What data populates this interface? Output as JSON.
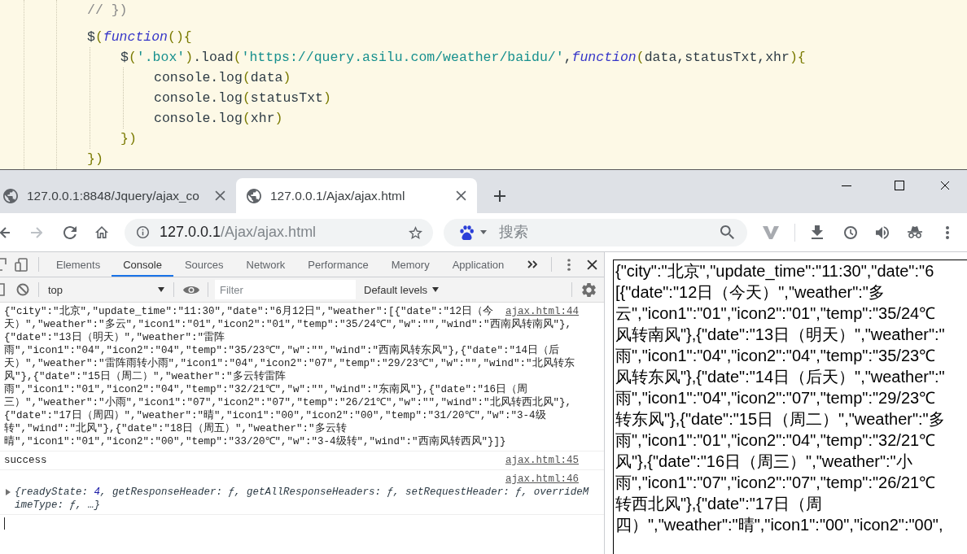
{
  "editor": {
    "lines": [
      {
        "kind": "code",
        "tokens": [
          {
            "kind": "comment",
            "text": "// })"
          }
        ]
      },
      {
        "kind": "blank"
      },
      {
        "kind": "code",
        "tokens": [
          {
            "kind": "plain",
            "text": "$"
          },
          {
            "kind": "punct",
            "text": "("
          },
          {
            "kind": "keyword",
            "text": "function"
          },
          {
            "kind": "punct",
            "text": "(){"
          }
        ],
        "children": [
          {
            "kind": "code",
            "tokens": [
              {
                "kind": "plain",
                "text": "$"
              },
              {
                "kind": "punct",
                "text": "("
              },
              {
                "kind": "string",
                "text": "'.box'"
              },
              {
                "kind": "punct",
                "text": ")"
              },
              {
                "kind": "plain",
                "text": ".load"
              },
              {
                "kind": "punct",
                "text": "("
              },
              {
                "kind": "string",
                "text": "'https://query.asilu.com/weather/baidu/'"
              },
              {
                "kind": "plain",
                "text": ","
              },
              {
                "kind": "keyword",
                "text": "function"
              },
              {
                "kind": "punct",
                "text": "("
              },
              {
                "kind": "plain",
                "text": "data,statusTxt,xhr"
              },
              {
                "kind": "punct",
                "text": "){"
              }
            ],
            "children": [
              {
                "kind": "code",
                "tokens": [
                  {
                    "kind": "plain",
                    "text": "console.log"
                  },
                  {
                    "kind": "punct",
                    "text": "("
                  },
                  {
                    "kind": "plain",
                    "text": "data"
                  },
                  {
                    "kind": "punct",
                    "text": ")"
                  }
                ]
              },
              {
                "kind": "code",
                "tokens": [
                  {
                    "kind": "plain",
                    "text": "console.log"
                  },
                  {
                    "kind": "punct",
                    "text": "("
                  },
                  {
                    "kind": "plain",
                    "text": "statusTxt"
                  },
                  {
                    "kind": "punct",
                    "text": ")"
                  }
                ]
              },
              {
                "kind": "code",
                "tokens": [
                  {
                    "kind": "plain",
                    "text": "console.log"
                  },
                  {
                    "kind": "punct",
                    "text": "("
                  },
                  {
                    "kind": "plain",
                    "text": "xhr"
                  },
                  {
                    "kind": "punct",
                    "text": ")"
                  }
                ]
              }
            ]
          },
          {
            "kind": "code",
            "tokens": [
              {
                "kind": "punct",
                "text": "})"
              }
            ]
          }
        ]
      },
      {
        "kind": "code",
        "tokens": [
          {
            "kind": "punct",
            "text": "})"
          }
        ]
      }
    ]
  },
  "browser": {
    "tabs": [
      {
        "title": "127.0.0.1:8848/Jquery/ajax_co",
        "selected": false
      },
      {
        "title": "127.0.0.1/Ajax/ajax.html",
        "selected": true
      }
    ],
    "address": {
      "host": "127.0.0.1",
      "path": "/Ajax/ajax.html"
    },
    "search": {
      "placeholder": "搜索"
    }
  },
  "devtools": {
    "tabs": [
      {
        "label": "Elements",
        "selected": false
      },
      {
        "label": "Console",
        "selected": true
      },
      {
        "label": "Sources",
        "selected": false
      },
      {
        "label": "Network",
        "selected": false
      },
      {
        "label": "Performance",
        "selected": false
      },
      {
        "label": "Memory",
        "selected": false
      },
      {
        "label": "Application",
        "selected": false
      }
    ],
    "context": "top",
    "filter_placeholder": "Filter",
    "levels": "Default levels",
    "messages": [
      {
        "kind": "text",
        "source": "ajax.html:44",
        "lines": [
          "{\"city\":\"北京\",\"update_time\":\"11:30\",\"date\":\"6月12日\",\"weather\":[{\"date\":\"12日（今",
          "天）\",\"weather\":\"多云\",\"icon1\":\"01\",\"icon2\":\"01\",\"temp\":\"35/24℃\",\"w\":\"\",\"wind\":\"西南风转南风\"},",
          "{\"date\":\"13日（明天）\",\"weather\":\"雷阵",
          "雨\",\"icon1\":\"04\",\"icon2\":\"04\",\"temp\":\"35/23℃\",\"w\":\"\",\"wind\":\"西南风转东风\"},{\"date\":\"14日（后",
          "天）\",\"weather\":\"雷阵雨转小雨\",\"icon1\":\"04\",\"icon2\":\"07\",\"temp\":\"29/23℃\",\"w\":\"\",\"wind\":\"北风转东",
          "风\"},{\"date\":\"15日（周二）\",\"weather\":\"多云转雷阵",
          "雨\",\"icon1\":\"01\",\"icon2\":\"04\",\"temp\":\"32/21℃\",\"w\":\"\",\"wind\":\"东南风\"},{\"date\":\"16日（周",
          "三）\",\"weather\":\"小雨\",\"icon1\":\"07\",\"icon2\":\"07\",\"temp\":\"26/21℃\",\"w\":\"\",\"wind\":\"北风转西北风\"},",
          "{\"date\":\"17日（周四）\",\"weather\":\"晴\",\"icon1\":\"00\",\"icon2\":\"00\",\"temp\":\"31/20℃\",\"w\":\"3-4级",
          "转\",\"wind\":\"北风\"},{\"date\":\"18日（周五）\",\"weather\":\"多云转",
          "晴\",\"icon1\":\"01\",\"icon2\":\"00\",\"temp\":\"33/20℃\",\"w\":\"3-4级转\",\"wind\":\"西南风转西风\"}]}"
        ]
      },
      {
        "kind": "text",
        "source": "ajax.html:45",
        "lines": [
          "success"
        ]
      },
      {
        "kind": "object",
        "source": "ajax.html:46",
        "expanded": false,
        "lines": [
          [
            {
              "kind": "plain",
              "text": "{readyState: "
            },
            {
              "kind": "number",
              "text": "4"
            },
            {
              "kind": "plain",
              "text": ", getResponseHeader: ƒ, getAllResponseHeaders: ƒ, setRequestHeader: ƒ, overrideM"
            }
          ],
          [
            {
              "kind": "plain",
              "text": "imeType: ƒ, …}"
            }
          ]
        ]
      }
    ]
  },
  "page": {
    "lines": [
      "{\"city\":\"北京\",\"update_time\":\"11:30\",\"date\":\"6",
      "[{\"date\":\"12日（今天）\",\"weather\":\"多",
      "云\",\"icon1\":\"01\",\"icon2\":\"01\",\"temp\":\"35/24℃",
      "风转南风\"},{\"date\":\"13日（明天）\",\"weather\":\"",
      "雨\",\"icon1\":\"04\",\"icon2\":\"04\",\"temp\":\"35/23℃",
      "风转东风\"},{\"date\":\"14日（后天）\",\"weather\":\"",
      "雨\",\"icon1\":\"04\",\"icon2\":\"07\",\"temp\":\"29/23℃",
      "转东风\"},{\"date\":\"15日（周二）\",\"weather\":\"多",
      "雨\",\"icon1\":\"01\",\"icon2\":\"04\",\"temp\":\"32/21℃",
      "风\"},{\"date\":\"16日（周三）\",\"weather\":\"小",
      "雨\",\"icon1\":\"07\",\"icon2\":\"07\",\"temp\":\"26/21℃",
      "转西北风\"},{\"date\":\"17日（周",
      "四）\",\"weather\":\"晴\",\"icon1\":\"00\",\"icon2\":\"00\","
    ]
  }
}
